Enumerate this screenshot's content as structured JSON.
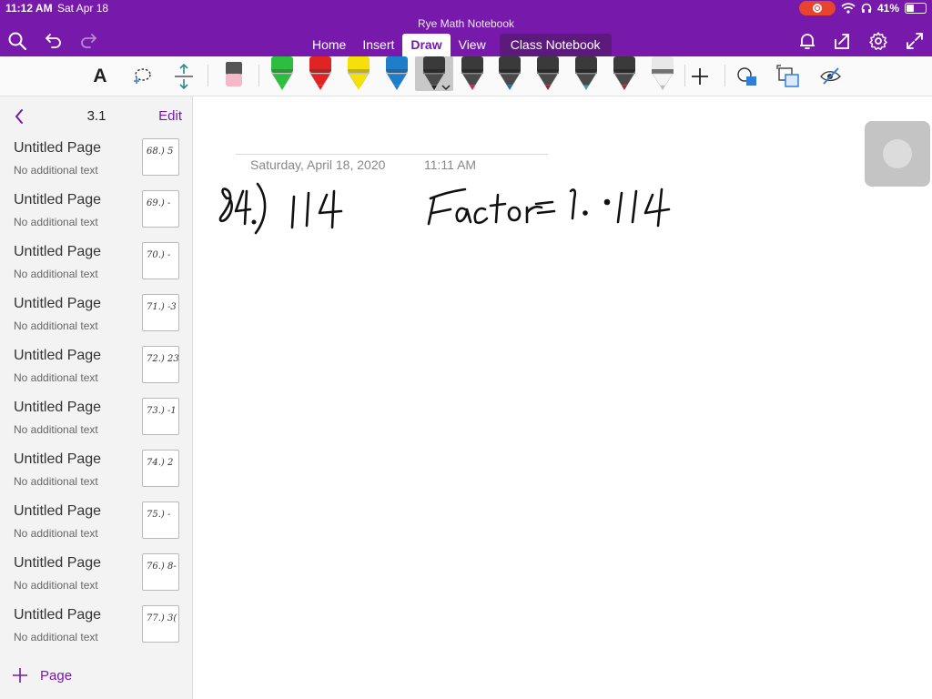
{
  "status": {
    "time": "11:12 AM",
    "date": "Sat Apr 18",
    "battery": "41%",
    "battery_level": 0.41
  },
  "app": {
    "notebook_title": "Rye Math Notebook",
    "tabs": [
      {
        "label": "Home",
        "active": false
      },
      {
        "label": "Insert",
        "active": false
      },
      {
        "label": "Draw",
        "active": true
      },
      {
        "label": "View",
        "active": false
      },
      {
        "label": "Class Notebook",
        "active": false
      }
    ]
  },
  "colors": {
    "brand": "#7719aa",
    "pens": [
      "#2dbd3f",
      "#e02424",
      "#f5e00a",
      "#1f7ecb",
      "#222222",
      "#d6225a",
      "#1f6fb6",
      "#a61c2e",
      "#3aa39b",
      "#b3213c",
      "#ffffff"
    ]
  },
  "sidebar": {
    "section_title": "3.1",
    "edit_label": "Edit",
    "add_page_label": "Page",
    "pages": [
      {
        "title": "Untitled Page",
        "subtitle": "No additional text",
        "thumb": "68.) 5"
      },
      {
        "title": "Untitled Page",
        "subtitle": "No additional text",
        "thumb": "69.) -"
      },
      {
        "title": "Untitled Page",
        "subtitle": "No additional text",
        "thumb": "70.) -"
      },
      {
        "title": "Untitled Page",
        "subtitle": "No additional text",
        "thumb": "71.) -3"
      },
      {
        "title": "Untitled Page",
        "subtitle": "No additional text",
        "thumb": "72.) 23"
      },
      {
        "title": "Untitled Page",
        "subtitle": "No additional text",
        "thumb": "73.) -1"
      },
      {
        "title": "Untitled Page",
        "subtitle": "No additional text",
        "thumb": "74.) 2"
      },
      {
        "title": "Untitled Page",
        "subtitle": "No additional text",
        "thumb": "75.) -"
      },
      {
        "title": "Untitled Page",
        "subtitle": "No additional text",
        "thumb": "76.) 8-"
      },
      {
        "title": "Untitled Page",
        "subtitle": "No additional text",
        "thumb": "77.) 3("
      }
    ]
  },
  "page": {
    "date": "Saturday, April 18, 2020",
    "time": "11:11 AM",
    "ink_line_1": "84.) 114",
    "ink_line_2": "Factor = 1.0114"
  }
}
